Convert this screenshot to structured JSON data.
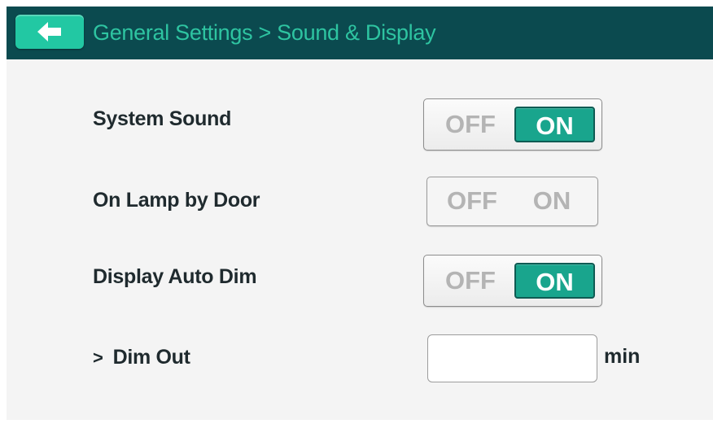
{
  "header": {
    "back_icon": "arrow-left-icon",
    "breadcrumb": "General Settings > Sound & Display"
  },
  "settings": [
    {
      "label": "System Sound",
      "off_label": "OFF",
      "on_label": "ON",
      "state": "ON"
    },
    {
      "label": "On Lamp by Door",
      "off_label": "OFF",
      "on_label": "ON",
      "state": "none"
    },
    {
      "label": "Display Auto Dim",
      "off_label": "OFF",
      "on_label": "ON",
      "state": "ON"
    }
  ],
  "dim_out": {
    "chevron": ">",
    "label": "Dim Out",
    "value": "",
    "unit": "min"
  },
  "colors": {
    "header_bg": "#0b4a4f",
    "accent": "#22c8a3",
    "breadcrumb_text": "#2ec4a1",
    "toggle_on_bg": "#19a58d",
    "panel_bg": "#f4f4f4"
  }
}
